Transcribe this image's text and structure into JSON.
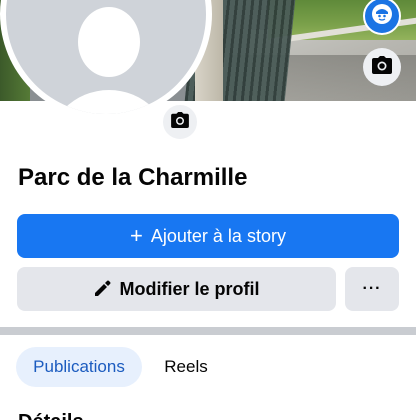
{
  "profile": {
    "name": "Parc de la Charmille"
  },
  "actions": {
    "add_story_label": "Ajouter à la story",
    "edit_profile_label": "Modifier le profil",
    "more_label": "···"
  },
  "tabs": [
    {
      "label": "Publications",
      "selected": true
    },
    {
      "label": "Reels",
      "selected": false
    }
  ],
  "section": {
    "title": "Détails"
  },
  "icons": {
    "cover_camera": "camera-icon",
    "profile_camera": "camera-icon",
    "avatar_switch": "messenger-avatar-icon",
    "edit": "pencil-icon",
    "add": "plus-icon"
  },
  "colors": {
    "primary": "#1877f2",
    "secondary_bg": "#e4e6eb",
    "tab_selected_bg": "#e7f0fd",
    "tab_selected_text": "#1b5bbf"
  }
}
